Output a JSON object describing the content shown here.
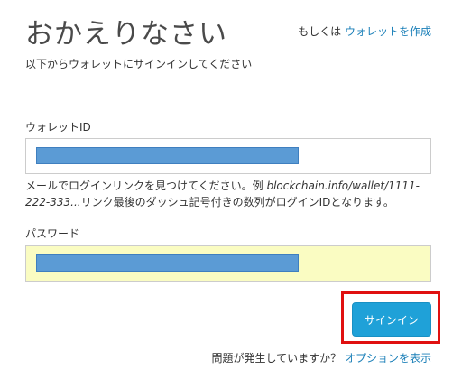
{
  "header": {
    "title": "おかえりなさい",
    "alt_prefix": "もしくは",
    "create_wallet_link": "ウォレットを作成",
    "subtitle": "以下からウォレットにサインインしてください"
  },
  "wallet_id": {
    "label": "ウォレットID",
    "value_redacted": true
  },
  "help": {
    "text_start": "メールでログインリンクを見つけてください。例 ",
    "example": "blockchain.info/wallet/1111-222-333...",
    "text_end": "リンク最後のダッシュ記号付きの数列がログインIDとなります。"
  },
  "password": {
    "label": "パスワード",
    "value_redacted": true
  },
  "actions": {
    "signin_label": "サインイン"
  },
  "footer": {
    "problem_text": "問題が発生していますか？",
    "options_link": "オプションを表示"
  },
  "colors": {
    "accent": "#1fa1d8",
    "link": "#1a7fb8",
    "highlight": "#e01010",
    "password_bg": "#fafcc2",
    "redaction": "#5b9bd5"
  }
}
